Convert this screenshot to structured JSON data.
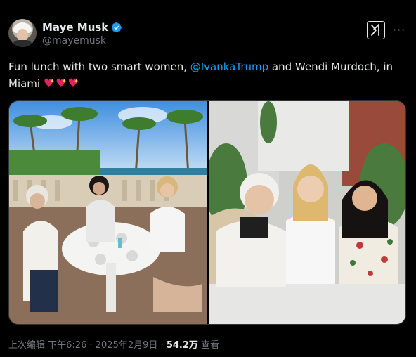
{
  "header": {
    "display_name": "Maye Musk",
    "handle": "@mayemusk"
  },
  "tweet": {
    "text_before": "Fun lunch with two smart women, ",
    "mention": "@IvankaTrump",
    "text_after": " and Wendi Murdoch, in Miami",
    "emoji": [
      "sparkling-heart",
      "sparkling-heart",
      "sparkling-heart"
    ]
  },
  "media": {
    "images": [
      {
        "icon": "lunch-table-photo"
      },
      {
        "icon": "three-women-portrait-photo"
      }
    ]
  },
  "footer": {
    "edited_label": "上次编辑",
    "time": "下午6:26",
    "sep1": " · ",
    "date": "2025年2月9日",
    "sep2": " · ",
    "views": "54.2万",
    "views_label": " 查看"
  },
  "icons": {
    "verified": "verified-badge-icon",
    "grok": "grok-icon",
    "more": "more-options-icon"
  },
  "colors": {
    "background": "#000000",
    "text": "#e7e9ea",
    "secondary": "#71767b",
    "accent": "#1d9bf0"
  }
}
